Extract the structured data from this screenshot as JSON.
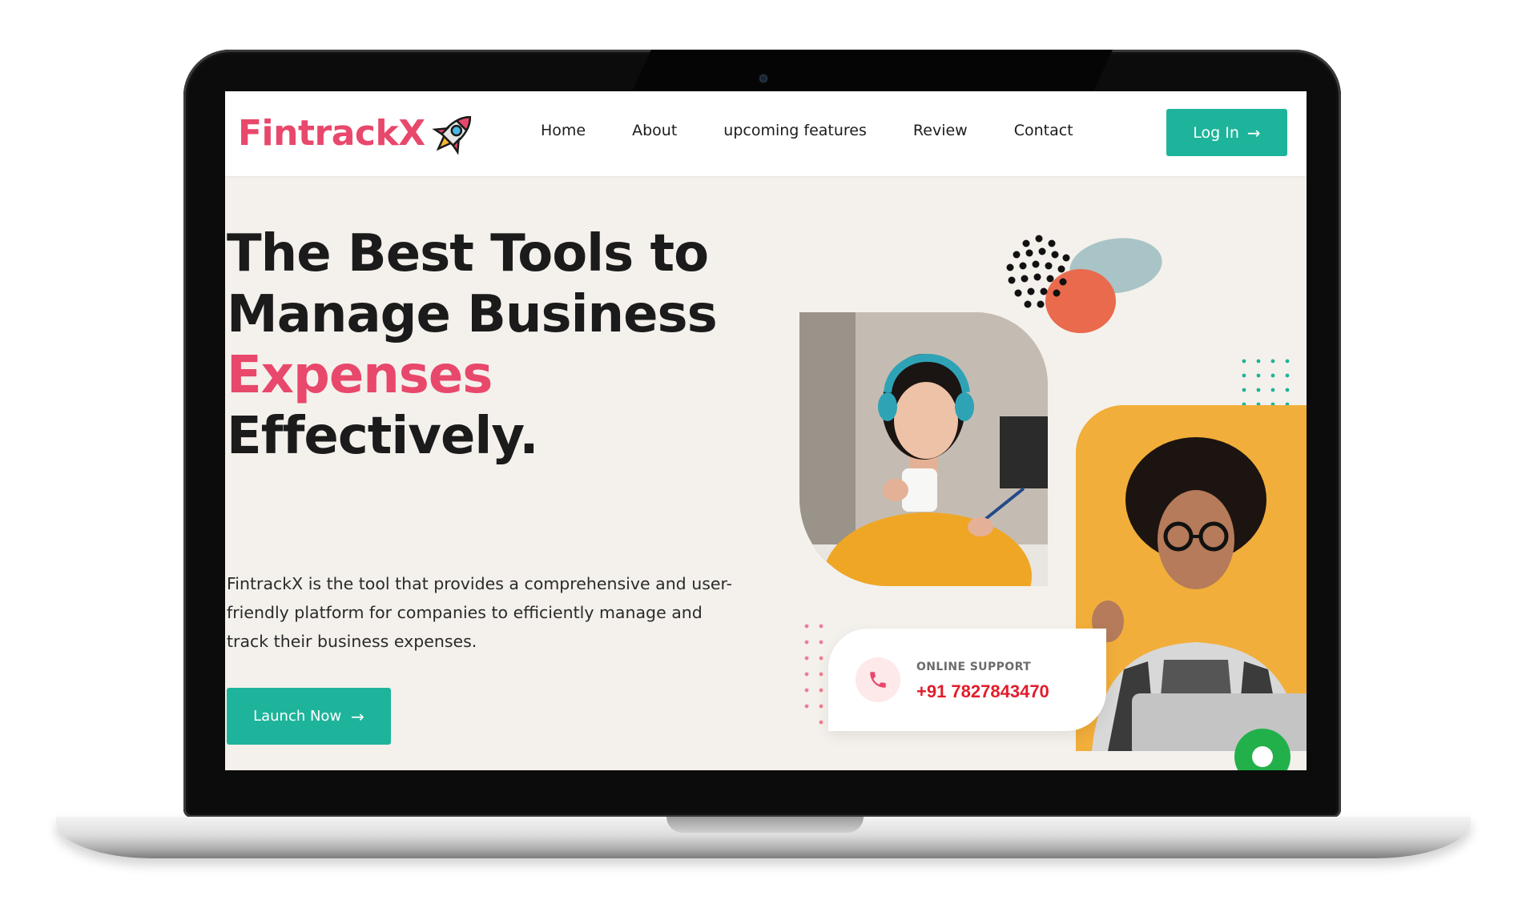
{
  "brand": {
    "name": "FintrackX",
    "logo_icon": "rocket-icon",
    "accent_color": "#e8486b",
    "primary_color": "#1eb49b"
  },
  "nav": {
    "items": [
      {
        "label": "Home"
      },
      {
        "label": "About"
      },
      {
        "label": "upcoming features"
      },
      {
        "label": "Review"
      },
      {
        "label": "Contact"
      }
    ],
    "login_label": "Log In"
  },
  "hero": {
    "title_line1": "The Best Tools to",
    "title_line2": "Manage Business",
    "title_accent": "Expenses",
    "title_line4": "Effectively.",
    "description": "FintrackX is the tool that provides a comprehensive and user-friendly platform for companies to efficiently manage and track their business expenses.",
    "cta_label": "Launch Now"
  },
  "support": {
    "label": "ONLINE SUPPORT",
    "phone": "+91 7827843470",
    "icon": "phone-icon"
  },
  "chat": {
    "icon": "chat-icon",
    "color": "#22b04b"
  }
}
